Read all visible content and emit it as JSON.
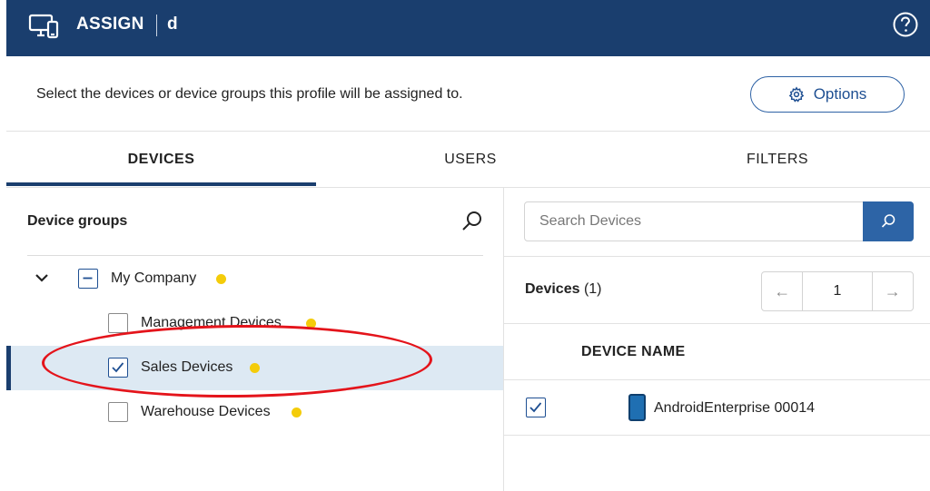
{
  "header": {
    "app_title": "ASSIGN",
    "profile_name": "d",
    "background_color": "#1a3e6e",
    "app_icon": "monitor-phone-icon",
    "help_icon": "help-circle-icon"
  },
  "intro_text": "Select the devices or device groups this profile will be assigned to.",
  "options_button": {
    "label": "Options",
    "icon": "gear-icon"
  },
  "tabs": [
    {
      "label": "DEVICES",
      "active": true
    },
    {
      "label": "USERS",
      "active": false
    },
    {
      "label": "FILTERS",
      "active": false
    }
  ],
  "device_groups": {
    "title": "Device groups",
    "items": [
      {
        "label": "My Company",
        "state": "indeterminate",
        "expanded": true
      },
      {
        "label": "Management Devices",
        "state": "unchecked"
      },
      {
        "label": "Sales Devices",
        "state": "checked",
        "selected": true
      },
      {
        "label": "Warehouse Devices",
        "state": "unchecked"
      }
    ],
    "status_dot_color": "#f4cc0a"
  },
  "search": {
    "placeholder": "Search Devices"
  },
  "devices_panel": {
    "title": "Devices",
    "count_text": "(1)",
    "page": "1",
    "prev_label": "←",
    "next_label": "→",
    "column_header": "DEVICE NAME",
    "rows": [
      {
        "name": "AndroidEnterprise 00014",
        "checked": true,
        "icon": "phone-icon"
      }
    ]
  },
  "annotation": {
    "color": "#e4141b",
    "target": "Sales Devices"
  }
}
